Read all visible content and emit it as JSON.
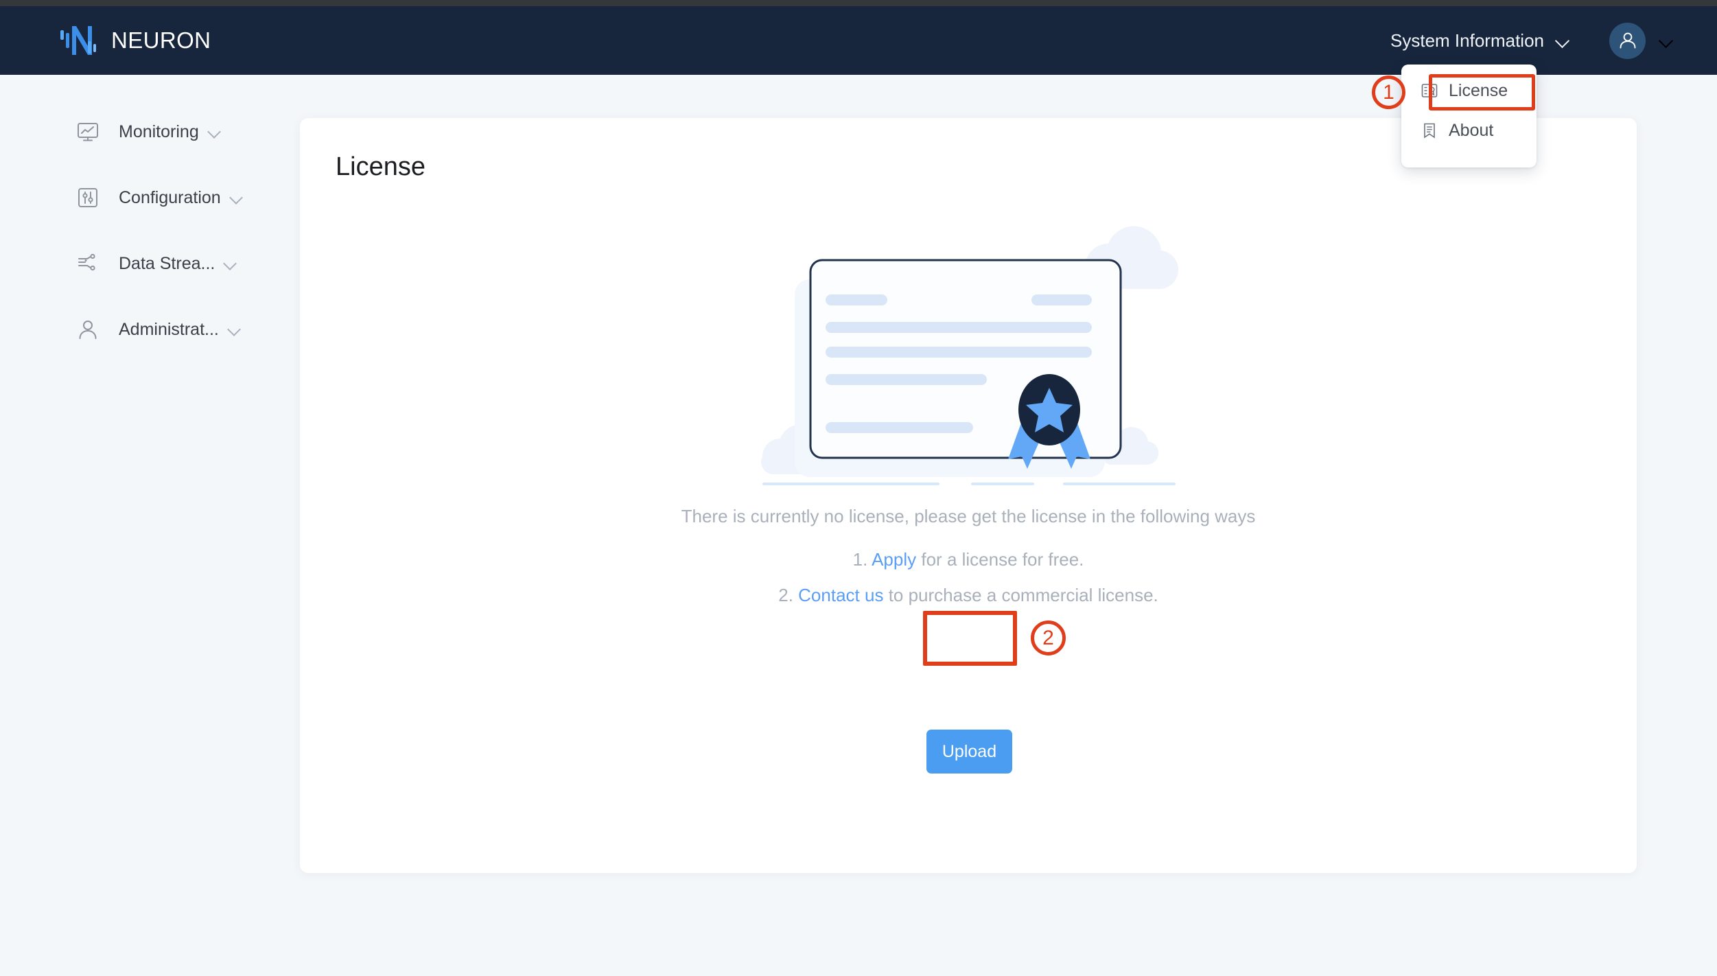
{
  "app": {
    "brand_name": "NEURON",
    "logo_icon": "neuron-logo-icon"
  },
  "topbar": {
    "system_information_label": "System Information",
    "system_information_chevron_icon": "chevron-down-icon",
    "avatar_icon": "user-avatar-icon",
    "avatar_chevron_icon": "chevron-down-icon"
  },
  "dropdown": {
    "items": [
      {
        "label": "License",
        "icon": "certificate-icon",
        "highlighted": true
      },
      {
        "label": "About",
        "icon": "bookmark-document-icon",
        "highlighted": false
      }
    ]
  },
  "annotations": [
    {
      "label": "1",
      "target": "License menu item",
      "color": "#e03e1a"
    },
    {
      "label": "2",
      "target": "Upload button",
      "color": "#e03e1a"
    }
  ],
  "sidebar": {
    "items": [
      {
        "label": "Monitoring",
        "icon": "monitor-chart-icon",
        "chevron": "chevron-down-icon"
      },
      {
        "label": "Configuration",
        "icon": "sliders-icon",
        "chevron": "chevron-down-icon"
      },
      {
        "label": "Data Strea...",
        "icon": "data-stream-icon",
        "chevron": "chevron-down-icon"
      },
      {
        "label": "Administrat...",
        "icon": "user-icon",
        "chevron": "chevron-down-icon"
      }
    ]
  },
  "main": {
    "page_title": "License",
    "illustration": "license-certificate-illustration",
    "empty_message": "There is currently no license, please get the license in the following ways",
    "options": [
      {
        "number": "1.",
        "link": "Apply",
        "rest": "for a license for free."
      },
      {
        "number": "2.",
        "link": "Contact us",
        "rest": "to purchase a commercial license."
      }
    ],
    "upload_label": "Upload"
  },
  "colors": {
    "header_bg": "#17263c",
    "page_bg": "#f4f7fa",
    "card_bg": "#ffffff",
    "brand_blue": "#4a9df0",
    "link_blue": "#5a9ef5",
    "annotation_red": "#e03e1a",
    "muted_text": "#a9b0ba",
    "avatar_bg": "#2d5379",
    "chrome_strip": "#35383b"
  }
}
